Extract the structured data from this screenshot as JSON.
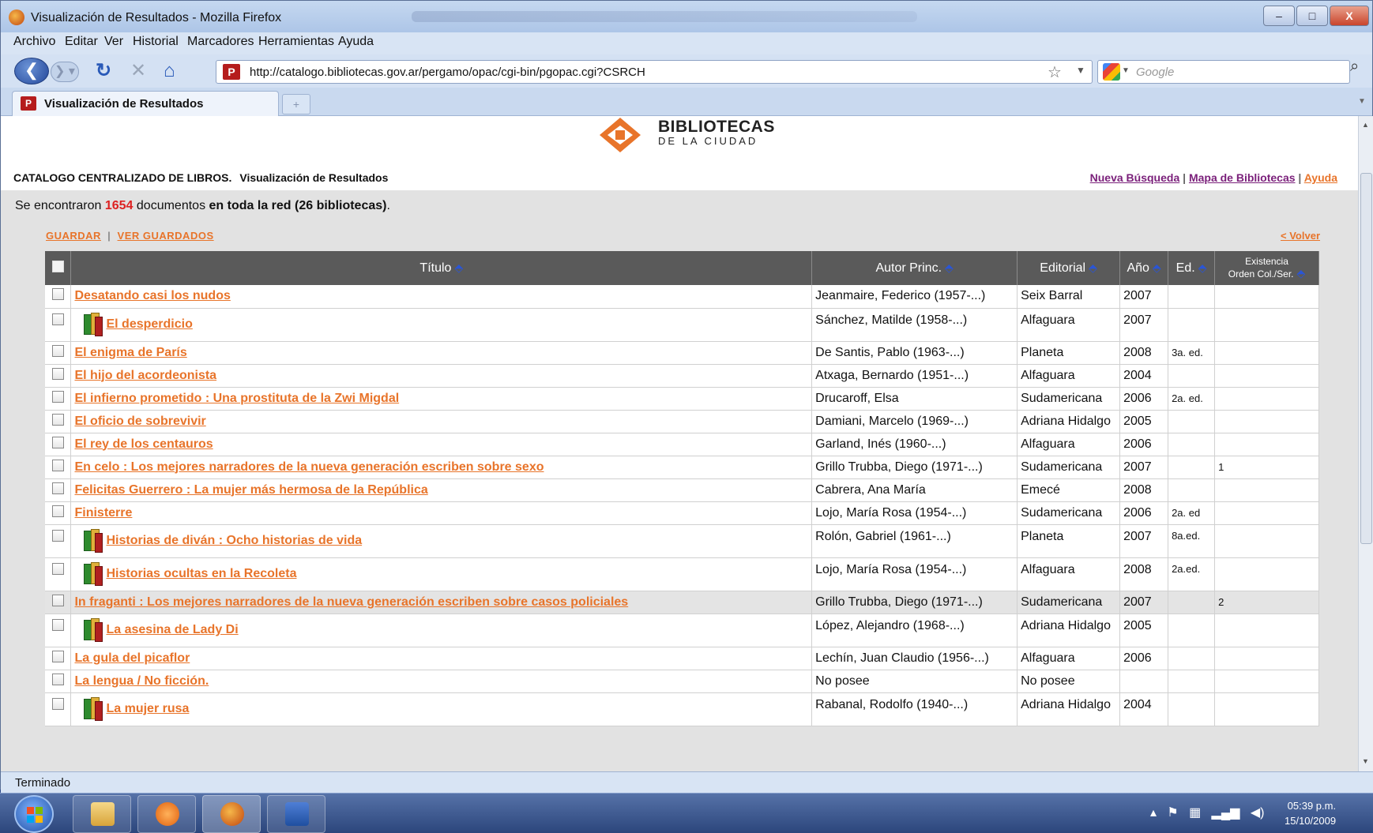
{
  "window": {
    "title": "Visualización de Resultados - Mozilla Firefox",
    "controls": {
      "minimize": "–",
      "maximize": "□",
      "close": "X"
    }
  },
  "menu": [
    "Archivo",
    "Editar",
    "Ver",
    "Historial",
    "Marcadores",
    "Herramientas",
    "Ayuda"
  ],
  "navbar": {
    "url": "http://catalogo.bibliotecas.gov.ar/pergamo/opac/cgi-bin/pgopac.cgi?CSRCH",
    "search_placeholder": "Google",
    "site_icon_letter": "P"
  },
  "tab": {
    "label": "Visualización de Resultados",
    "new_tab": "+"
  },
  "logo": {
    "line1": "BIBLIOTECAS",
    "line2": "DE LA CIUDAD"
  },
  "header": {
    "catalog": "CATALOGO CENTRALIZADO DE LIBROS.",
    "subtitle": "Visualización de Resultados",
    "links": [
      "Nueva Búsqueda",
      "Mapa de Bibliotecas",
      "Ayuda"
    ]
  },
  "summary": {
    "prefix": "Se encontraron",
    "count": "1654",
    "middle": "documentos",
    "scope": "en toda la red (26 bibliotecas)",
    "suffix": "."
  },
  "actions": {
    "save": "GUARDAR",
    "view_saved": "VER GUARDADOS",
    "back": "< Volver"
  },
  "columns": {
    "title": "Título",
    "author": "Autor Princ.",
    "publisher": "Editorial",
    "year": "Año",
    "edition": "Ed.",
    "holdings_line1": "Existencia",
    "holdings_line2": "Orden Col./Ser."
  },
  "rows": [
    {
      "title": "Desatando casi los nudos",
      "author": "Jeanmaire, Federico (1957-...)",
      "publisher": "Seix Barral",
      "year": "2007",
      "edition": "",
      "holdings": "",
      "icon": false
    },
    {
      "title": "El desperdicio",
      "author": "Sánchez, Matilde (1958-...)",
      "publisher": "Alfaguara",
      "year": "2007",
      "edition": "",
      "holdings": "",
      "icon": true
    },
    {
      "title": "El enigma de París",
      "author": "De Santis, Pablo (1963-...)",
      "publisher": "Planeta",
      "year": "2008",
      "edition": "3a. ed.",
      "holdings": "",
      "icon": false
    },
    {
      "title": "El hijo del acordeonista",
      "author": "Atxaga, Bernardo (1951-...)",
      "publisher": "Alfaguara",
      "year": "2004",
      "edition": "",
      "holdings": "",
      "icon": false
    },
    {
      "title": "El infierno prometido : Una prostituta de la Zwi Migdal",
      "author": "Drucaroff, Elsa",
      "publisher": "Sudamericana",
      "year": "2006",
      "edition": "2a. ed.",
      "holdings": "",
      "icon": false
    },
    {
      "title": "El oficio de sobrevivir",
      "author": "Damiani, Marcelo (1969-...)",
      "publisher": "Adriana Hidalgo",
      "year": "2005",
      "edition": "",
      "holdings": "",
      "icon": false
    },
    {
      "title": "El rey de los centauros",
      "author": "Garland, Inés (1960-...)",
      "publisher": "Alfaguara",
      "year": "2006",
      "edition": "",
      "holdings": "",
      "icon": false
    },
    {
      "title": "En celo : Los mejores narradores de la nueva generación escriben sobre sexo",
      "author": "Grillo Trubba, Diego (1971-...)",
      "publisher": "Sudamericana",
      "year": "2007",
      "edition": "",
      "holdings": "1",
      "icon": false
    },
    {
      "title": "Felicitas Guerrero : La mujer más hermosa de la República",
      "author": "Cabrera, Ana María",
      "publisher": "Emecé",
      "year": "2008",
      "edition": "",
      "holdings": "",
      "icon": false
    },
    {
      "title": "Finisterre",
      "author": "Lojo, María Rosa (1954-...)",
      "publisher": "Sudamericana",
      "year": "2006",
      "edition": "2a. ed",
      "holdings": "",
      "icon": false
    },
    {
      "title": "Historias de diván : Ocho historias de vida",
      "author": "Rolón, Gabriel (1961-...)",
      "publisher": "Planeta",
      "year": "2007",
      "edition": "8a.ed.",
      "holdings": "",
      "icon": true
    },
    {
      "title": "Historias ocultas en la Recoleta",
      "author": "Lojo, María Rosa (1954-...)",
      "publisher": "Alfaguara",
      "year": "2008",
      "edition": "2a.ed.",
      "holdings": "",
      "icon": true
    },
    {
      "title": "In fraganti : Los mejores narradores de la nueva generación escriben sobre casos policiales",
      "author": "Grillo Trubba, Diego (1971-...)",
      "publisher": "Sudamericana",
      "year": "2007",
      "edition": "",
      "holdings": "2",
      "icon": false,
      "highlight": true
    },
    {
      "title": "La asesina de Lady Di",
      "author": "López, Alejandro (1968-...)",
      "publisher": "Adriana Hidalgo",
      "year": "2005",
      "edition": "",
      "holdings": "",
      "icon": true
    },
    {
      "title": "La gula del picaflor",
      "author": "Lechín, Juan Claudio (1956-...)",
      "publisher": "Alfaguara",
      "year": "2006",
      "edition": "",
      "holdings": "",
      "icon": false
    },
    {
      "title": "La lengua / No ficción.",
      "author": "No posee",
      "publisher": "No posee",
      "year": "",
      "edition": "",
      "holdings": "",
      "icon": false
    },
    {
      "title": "La mujer rusa",
      "author": "Rabanal, Rodolfo (1940-...)",
      "publisher": "Adriana Hidalgo",
      "year": "2004",
      "edition": "",
      "holdings": "",
      "icon": true
    }
  ],
  "status": "Terminado",
  "clock": {
    "time": "05:39 p.m.",
    "date": "15/10/2009"
  },
  "colors": {
    "link": "#e8742a",
    "count": "#dd2222",
    "header_bg": "#5a5a5a",
    "visited": "#7a1f7a"
  }
}
